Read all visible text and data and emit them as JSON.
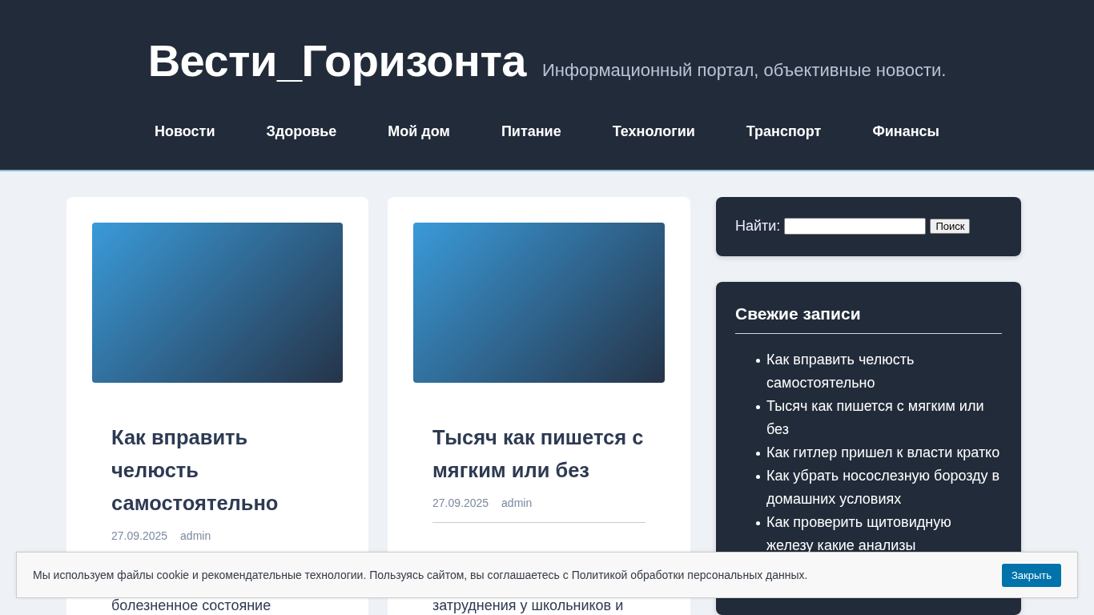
{
  "header": {
    "site_title": "Вести_Горизонта",
    "tagline": "Информационный портал, объективные новости."
  },
  "nav": [
    "Новости",
    "Здоровье",
    "Мой дом",
    "Питание",
    "Технологии",
    "Транспорт",
    "Финансы"
  ],
  "posts": [
    {
      "title": "Как вправить челюсть самостоятельно",
      "date": "27.09.2025",
      "author": "admin",
      "excerpt_lines": [
        "болезненное состояние"
      ]
    },
    {
      "title": "Тысяч как пишется с мягким или без",
      "date": "27.09.2025",
      "author": "admin",
      "excerpt_lines": [
        "затруднения у школьников и"
      ]
    }
  ],
  "search_widget": {
    "label": "Найти:",
    "button": "Поиск"
  },
  "recent_posts": {
    "title": "Свежие записи",
    "items": [
      "Как вправить челюсть самостоятельно",
      "Тысяч как пишется с мягким или без",
      "Как гитлер пришел к власти кратко",
      "Как убрать носослезную борозду в домашних условиях",
      "Как проверить щитовидную железу какие анализы"
    ]
  },
  "cookie_bar": {
    "text": "Мы используем файлы cookie и рекомендательные технологии. Пользуясь сайтом, вы соглашаетесь с Политикой обработки персональных данных.",
    "button": "Закрыть"
  }
}
